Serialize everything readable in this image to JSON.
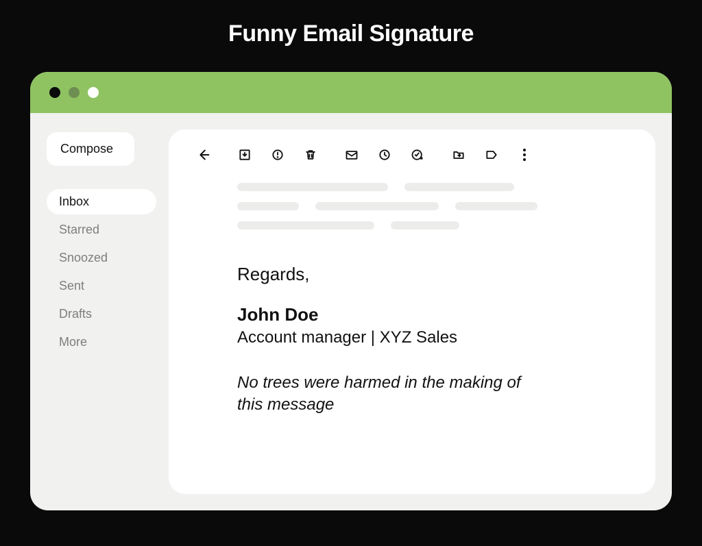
{
  "page": {
    "title": "Funny Email Signature"
  },
  "sidebar": {
    "compose": "Compose",
    "items": [
      {
        "label": "Inbox",
        "active": true
      },
      {
        "label": "Starred",
        "active": false
      },
      {
        "label": "Snoozed",
        "active": false
      },
      {
        "label": "Sent",
        "active": false
      },
      {
        "label": "Drafts",
        "active": false
      },
      {
        "label": "More",
        "active": false
      }
    ]
  },
  "toolbar": {
    "icons": [
      "back-icon",
      "archive-icon",
      "report-spam-icon",
      "delete-icon",
      "mark-unread-icon",
      "snooze-icon",
      "add-to-tasks-icon",
      "move-to-icon",
      "labels-icon",
      "more-icon"
    ]
  },
  "signature": {
    "greeting": "Regards,",
    "name": "John Doe",
    "title": "Account manager | XYZ Sales",
    "quote": "No trees were harmed in the making of this message"
  },
  "colors": {
    "titlebar": "#8fc362",
    "background": "#0a0a0a",
    "panel": "#f1f1f0"
  }
}
